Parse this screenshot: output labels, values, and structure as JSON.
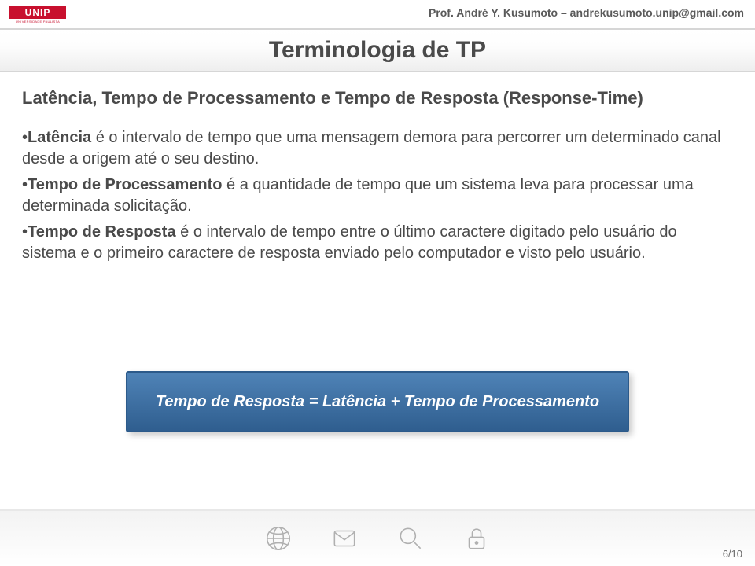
{
  "header": "Prof. André Y. Kusumoto – andrekusumoto.unip@gmail.com",
  "logo": {
    "brand": "UNIP",
    "sub": "UNIVERSIDADE PAULISTA"
  },
  "title": "Terminologia de TP",
  "subtitle": "Latência, Tempo de Processamento e Tempo de Resposta (Response-Time)",
  "bullets": {
    "b1_term": "Latência",
    "b1_rest": " é o intervalo de tempo que uma mensagem demora para percorrer um determinado canal desde a origem até o seu destino.",
    "b2_term": "Tempo de Processamento",
    "b2_rest": " é a quantidade de tempo que um sistema leva para processar uma determinada solicitação.",
    "b3_term": "Tempo de Resposta",
    "b3_rest": " é o intervalo de tempo entre o último caractere digitado pelo usuário do sistema e o primeiro caractere de resposta enviado pelo computador e visto pelo usuário."
  },
  "formula": "Tempo de Resposta = Latência + Tempo de Processamento",
  "page": "6/10"
}
